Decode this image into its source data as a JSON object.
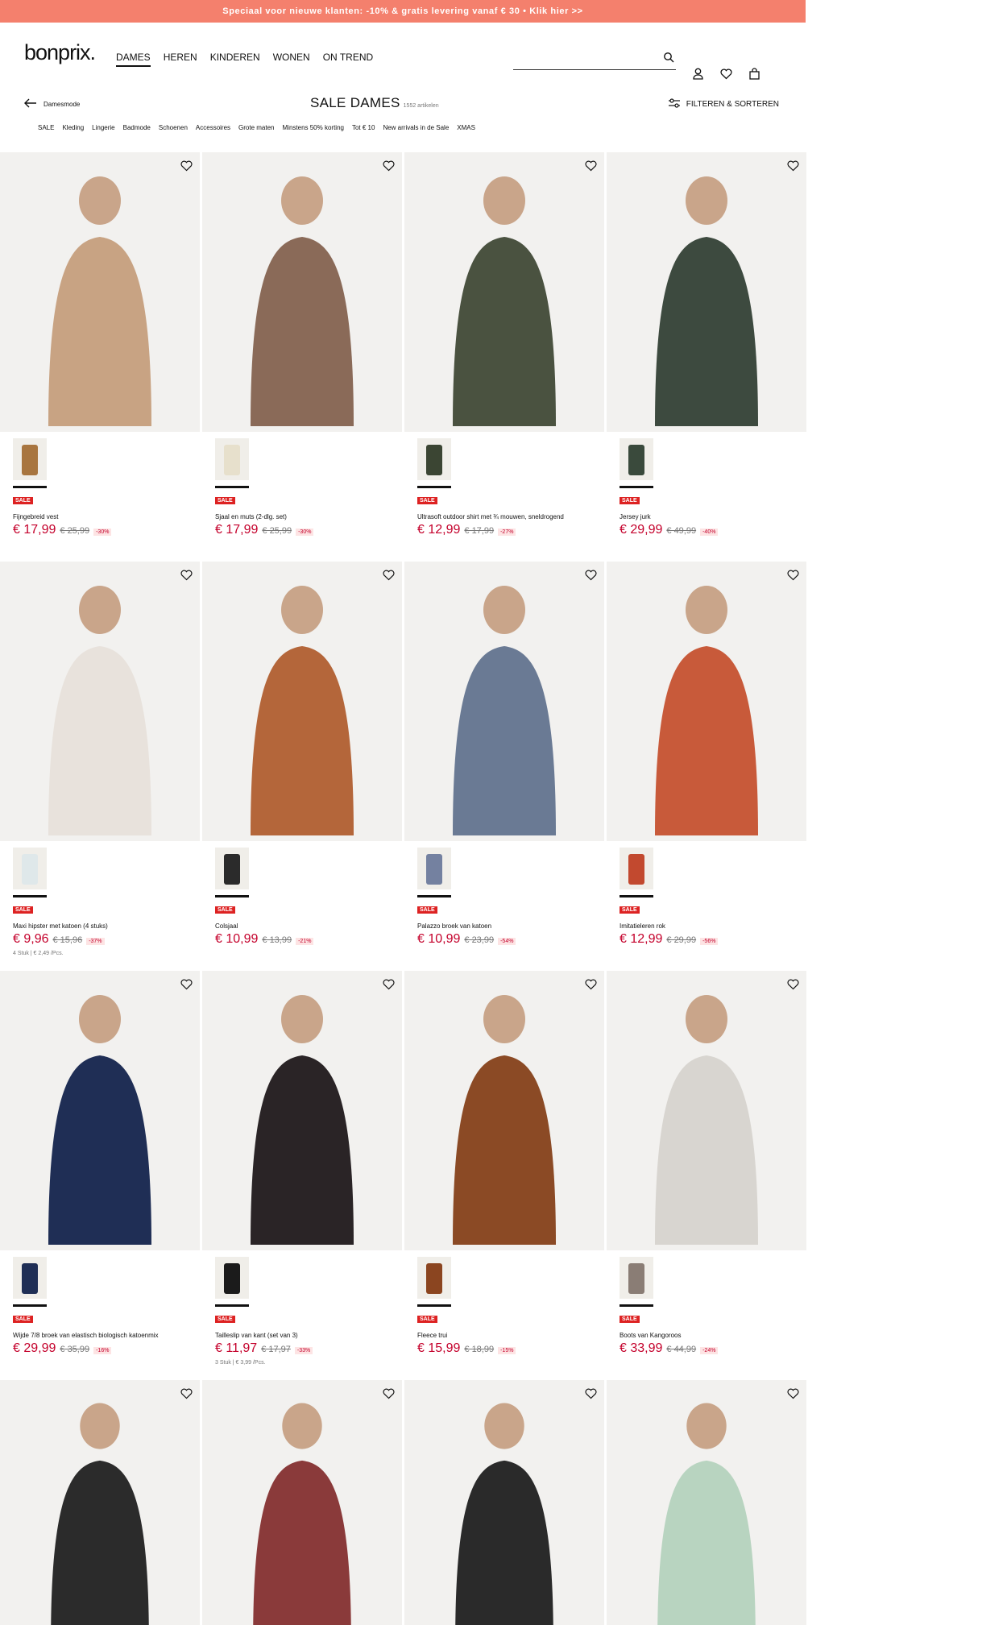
{
  "promo": "Speciaal voor nieuwe klanten: -10% & gratis levering vanaf € 30 • Klik hier >>",
  "logo": "bonprix.",
  "nav": [
    "DAMES",
    "HEREN",
    "KINDEREN",
    "WONEN",
    "ON TREND"
  ],
  "search": {
    "placeholder": ""
  },
  "back": "Damesmode",
  "title": "SALE DAMES",
  "count": "1552 artikelen",
  "filter": "FILTEREN & SORTEREN",
  "categories": [
    "SALE",
    "Kleding",
    "Lingerie",
    "Badmode",
    "Schoenen",
    "Accessoires",
    "Grote maten",
    "Minstens 50% korting",
    "Tot € 10",
    "New arrivals in de Sale",
    "XMAS"
  ],
  "products": [
    {
      "name": "Fijngebreid vest",
      "now": "€ 17,99",
      "old": "€ 25,99",
      "disc": "-30%",
      "unit": ""
    },
    {
      "name": "Sjaal en muts (2-dlg. set)",
      "now": "€ 17,99",
      "old": "€ 25,99",
      "disc": "-30%",
      "unit": ""
    },
    {
      "name": "Ultrasoft outdoor shirt met ¾ mouwen, sneldrogend",
      "now": "€ 12,99",
      "old": "€ 17,99",
      "disc": "-27%",
      "unit": ""
    },
    {
      "name": "Jersey jurk",
      "now": "€ 29,99",
      "old": "€ 49,99",
      "disc": "-40%",
      "unit": ""
    },
    {
      "name": "Maxi hipster met katoen (4 stuks)",
      "now": "€ 9,96",
      "old": "€ 15,96",
      "disc": "-37%",
      "unit": "4 Stuk | € 2,49 /Pcs."
    },
    {
      "name": "Colsjaal",
      "now": "€ 10,99",
      "old": "€ 13,99",
      "disc": "-21%",
      "unit": ""
    },
    {
      "name": "Palazzo broek van katoen",
      "now": "€ 10,99",
      "old": "€ 23,99",
      "disc": "-54%",
      "unit": ""
    },
    {
      "name": "Imitatieleren rok",
      "now": "€ 12,99",
      "old": "€ 29,99",
      "disc": "-56%",
      "unit": ""
    },
    {
      "name": "Wijde 7/8 broek van elastisch biologisch katoenmix",
      "now": "€ 29,99",
      "old": "€ 35,99",
      "disc": "-16%",
      "unit": ""
    },
    {
      "name": "Tailleslip van kant (set van 3)",
      "now": "€ 11,97",
      "old": "€ 17,97",
      "disc": "-33%",
      "unit": "3 Stuk | € 3,99 /Pcs."
    },
    {
      "name": "Fleece trui",
      "now": "€ 15,99",
      "old": "€ 18,99",
      "disc": "-15%",
      "unit": ""
    },
    {
      "name": "Boots van Kangoroos",
      "now": "€ 33,99",
      "old": "€ 44,99",
      "disc": "-24%",
      "unit": ""
    }
  ],
  "sale_badge": "SALE",
  "colors": {
    "promo": "#f4806d",
    "price": "#c4002b",
    "sale": "#dd2222"
  }
}
